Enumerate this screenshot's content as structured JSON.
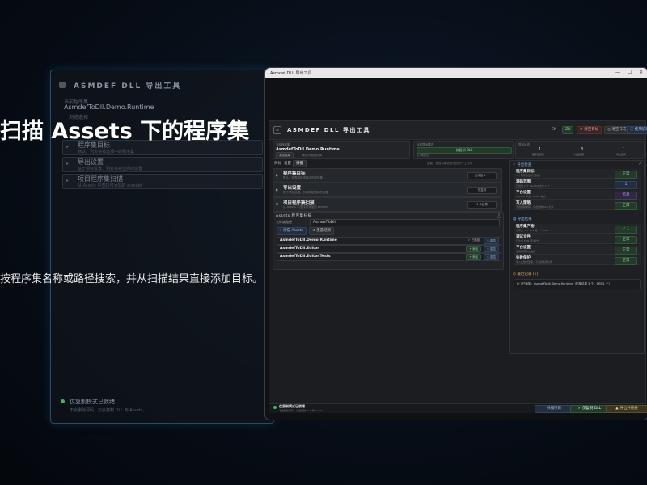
{
  "bg_panel": {
    "title": "ASMDEF DLL 导出工具",
    "sub1": "当前程序集",
    "current": "AsmdefToDll.Demo.Runtime",
    "sub2": "浏览选择",
    "rows": [
      {
        "title": "程序集目标",
        "sub": "默认、列表将被选择中的程序集"
      },
      {
        "title": "导出设置",
        "sub": "基于项目设置、列表将被选择的设置"
      },
      {
        "title": "项目程序集扫描",
        "sub": "从 Assets 中查找可添加的 asmdef"
      }
    ],
    "ready": "仅复制模式已就绪",
    "ready_sub": "不会删除源码。只会复制 DLL 到 Assets。"
  },
  "overlay": {
    "headline": "扫描 Assets 下的程序集",
    "caption": "按程序集名称或路径搜索，并从扫描结果直接添加目标。"
  },
  "window": {
    "title": "Asmdef DLL 导出工具",
    "app_title": "ASMDEF DLL 导出工具",
    "lang": "EN",
    "lang2": "ZH",
    "btn_clear": "✕ 清空目标",
    "btn_log": "◎ 清空日志",
    "btn_guide": "ⓘ 使用说明",
    "info1_label": "当前程序集",
    "info1_value": "AsmdefToDll.Demo.Runtime",
    "info1_btn": "浏览选择",
    "info1_hint": "或从扫描结果选择",
    "info2_label": "当前导出模式",
    "info2_value": "仅复制 DLL",
    "info2_hint": "写入前检查",
    "info3_label": "导出状态",
    "stats": [
      {
        "num": "1",
        "label": "程序集目标"
      },
      {
        "num": "3",
        "label": "扫描结果"
      },
      {
        "num": "1",
        "label": "导出任务"
      }
    ],
    "tabs": [
      "目标",
      "设置",
      "扫描"
    ],
    "tab_hint": "配置、检查与最近导出的同一工作流",
    "rows": [
      {
        "title": "程序集目标",
        "sub": "默认、列表将被选择中的程序集",
        "value": "已添加 1 个"
      },
      {
        "title": "导出设置",
        "sub": "基于项目设置、列表将被选择的设置",
        "value": "仅复制"
      },
      {
        "title": "项目程序集扫描",
        "sub": "从 Assets 中查找可添加的 asmdef",
        "value": "3 个结果"
      }
    ],
    "scan": {
      "header": "Assets 程序集扫描",
      "search_label": "名称或路径",
      "search_value": "AsmdefToDll",
      "btn_scan": "扫描 Assets",
      "btn_reset": "重置结果",
      "results": [
        {
          "name": "AsmdefToDll.Demo.Runtime",
          "tag": "✓ 已添加",
          "btn2": "◌ 定位"
        },
        {
          "name": "AsmdefToDll.Editor",
          "tag": "+ 添加",
          "btn2": "◌ 定位"
        },
        {
          "name": "AsmdefToDll.Editor.Tests",
          "tag": "+ 添加",
          "btn2": "◌ 定位"
        }
      ]
    },
    "preflight": {
      "title": "导出检查",
      "items": [
        {
          "h": "程序集目标",
          "s": "1 个程序集目标已就绪",
          "btn": "正常"
        },
        {
          "h": "源码范围",
          "s": "已找到 1 个 asmdef 文件 1 个",
          "btn": "1"
        },
        {
          "h": "平台设置",
          "s": "Anycpu 平台 · Editor 模式",
          "btn": "信息"
        },
        {
          "h": "写入策略",
          "s": "不会删除源码，只会复制 DLL 文件",
          "btn": "正常"
        }
      ]
    },
    "output": {
      "title": "导出结果",
      "items": [
        {
          "h": "程序集产物",
          "s": "已写入 1 个 DLL 和 1 个 PDB",
          "btn": "✓ 1"
        },
        {
          "h": "调试文件",
          "s": "已生成 PDB 调试文件",
          "btn": "正常"
        },
        {
          "h": "平台设置",
          "s": "沿用原有平台设置",
          "btn": "正常"
        },
        {
          "h": "失败保护",
          "s": "写入失败时回滚，不会替换原文件",
          "btn": "正常"
        }
      ]
    },
    "log": {
      "title": "最近记录 (1)",
      "entry": "[✓] 已添加：AsmdefToDll.Demo.Runtime（扫描结果 3 个，添加 1 个）"
    },
    "footer": {
      "ready": "仅复制模式已就绪",
      "ready_sub": "不会删除源码，只会复制 DLL 到 Assets。",
      "btn_scan": "扫描项目",
      "btn_copy": "✓ 仅复制 DLL",
      "btn_export": "▲ 导出并替换"
    }
  }
}
